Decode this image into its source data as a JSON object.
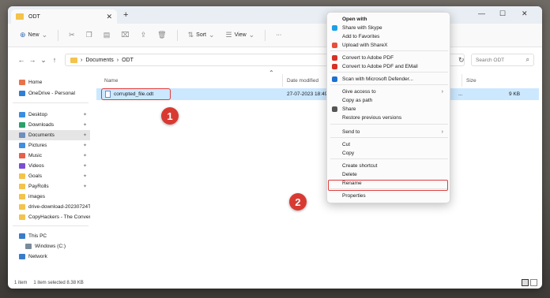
{
  "window": {
    "tab_title": "ODT",
    "tab_close": "✕",
    "new_tab": "+",
    "minimize": "—",
    "maximize": "☐",
    "close": "✕"
  },
  "toolbar": {
    "new_label": "New",
    "sort_label": "Sort",
    "view_label": "View",
    "more_label": "···"
  },
  "address": {
    "path": [
      "Documents",
      "ODT"
    ],
    "separator": "›",
    "search_placeholder": "Search ODT"
  },
  "sidebar": {
    "items": [
      {
        "label": "Home",
        "icon": "home-icon",
        "color": "#e8734a",
        "pinned": false
      },
      {
        "label": "OneDrive - Personal",
        "icon": "cloud-icon",
        "color": "#2f7fd6",
        "pinned": false
      },
      {
        "label": "Desktop",
        "icon": "desktop-icon",
        "color": "#3a8de0",
        "pinned": true
      },
      {
        "label": "Downloads",
        "icon": "download-icon",
        "color": "#2aa06a",
        "pinned": true
      },
      {
        "label": "Documents",
        "icon": "documents-icon",
        "color": "#6f8dbd",
        "pinned": true
      },
      {
        "label": "Pictures",
        "icon": "pictures-icon",
        "color": "#3f8ee0",
        "pinned": true
      },
      {
        "label": "Music",
        "icon": "music-icon",
        "color": "#e5604d",
        "pinned": true
      },
      {
        "label": "Videos",
        "icon": "videos-icon",
        "color": "#7a4fd1",
        "pinned": true
      },
      {
        "label": "Goals",
        "icon": "folder-icon",
        "color": "#f3c34b",
        "pinned": true
      },
      {
        "label": "PayRolls",
        "icon": "folder-icon",
        "color": "#f3c34b",
        "pinned": true
      },
      {
        "label": "images",
        "icon": "folder-icon",
        "color": "#f3c34b",
        "pinned": false
      },
      {
        "label": "drive-download-20230724T",
        "icon": "folder-icon",
        "color": "#f3c34b",
        "pinned": false
      },
      {
        "label": "CopyHackers - The Conver",
        "icon": "folder-icon",
        "color": "#f3c34b",
        "pinned": false
      },
      {
        "label": "This PC",
        "icon": "pc-icon",
        "color": "#3b7cc9",
        "pinned": false
      },
      {
        "label": "Windows (C:)",
        "icon": "drive-icon",
        "color": "#7a8a9a",
        "pinned": false
      },
      {
        "label": "Network",
        "icon": "network-icon",
        "color": "#3b7cc9",
        "pinned": false
      }
    ],
    "pin_glyph": "✦"
  },
  "list": {
    "headers": {
      "name": "Name",
      "date": "Date modified",
      "size": "Size"
    },
    "file": {
      "name": "corrupted_file.odt",
      "date": "27-07-2023 18:49",
      "type": "...",
      "size": "9 KB"
    }
  },
  "status": {
    "count": "1 item",
    "selected": "1 item selected  8.38 KB"
  },
  "context_menu": {
    "items": [
      {
        "label": "Open with",
        "bold": true,
        "icon": null,
        "color": null,
        "submenu": false
      },
      {
        "label": "Share with Skype",
        "bold": false,
        "icon": "skype-icon",
        "color": "#1aa1e6",
        "submenu": false
      },
      {
        "label": "Add to Favorites",
        "bold": false,
        "icon": null,
        "color": null,
        "submenu": false
      },
      {
        "label": "Upload with ShareX",
        "bold": false,
        "icon": "sharex-icon",
        "color": "#e84e3c",
        "submenu": false
      },
      {
        "label": "Convert to Adobe PDF",
        "bold": false,
        "icon": "adobe-pdf-icon",
        "color": "#d93025",
        "submenu": false
      },
      {
        "label": "Convert to Adobe PDF and EMail",
        "bold": false,
        "icon": "adobe-pdf-email-icon",
        "color": "#d93025",
        "submenu": false
      },
      {
        "label": "Scan with Microsoft Defender...",
        "bold": false,
        "icon": "defender-icon",
        "color": "#1f6fd0",
        "submenu": false
      },
      {
        "label": "Give access to",
        "bold": false,
        "icon": null,
        "color": null,
        "submenu": true
      },
      {
        "label": "Copy as path",
        "bold": false,
        "icon": null,
        "color": null,
        "submenu": false
      },
      {
        "label": "Share",
        "bold": false,
        "icon": "share-icon",
        "color": "#555555",
        "submenu": false
      },
      {
        "label": "Restore previous versions",
        "bold": false,
        "icon": null,
        "color": null,
        "submenu": false
      },
      {
        "label": "Send to",
        "bold": false,
        "icon": null,
        "color": null,
        "submenu": true
      },
      {
        "label": "Cut",
        "bold": false,
        "icon": null,
        "color": null,
        "submenu": false
      },
      {
        "label": "Copy",
        "bold": false,
        "icon": null,
        "color": null,
        "submenu": false
      },
      {
        "label": "Create shortcut",
        "bold": false,
        "icon": null,
        "color": null,
        "submenu": false
      },
      {
        "label": "Delete",
        "bold": false,
        "icon": null,
        "color": null,
        "submenu": false
      },
      {
        "label": "Rename",
        "bold": false,
        "icon": null,
        "color": null,
        "submenu": false
      },
      {
        "label": "Properties",
        "bold": false,
        "icon": null,
        "color": null,
        "submenu": false
      }
    ],
    "arrow": "›"
  },
  "markers": [
    "1",
    "2"
  ],
  "colors": {
    "accent": "#cce8ff",
    "highlight": "#e03b3b",
    "marker": "#d83a32"
  }
}
